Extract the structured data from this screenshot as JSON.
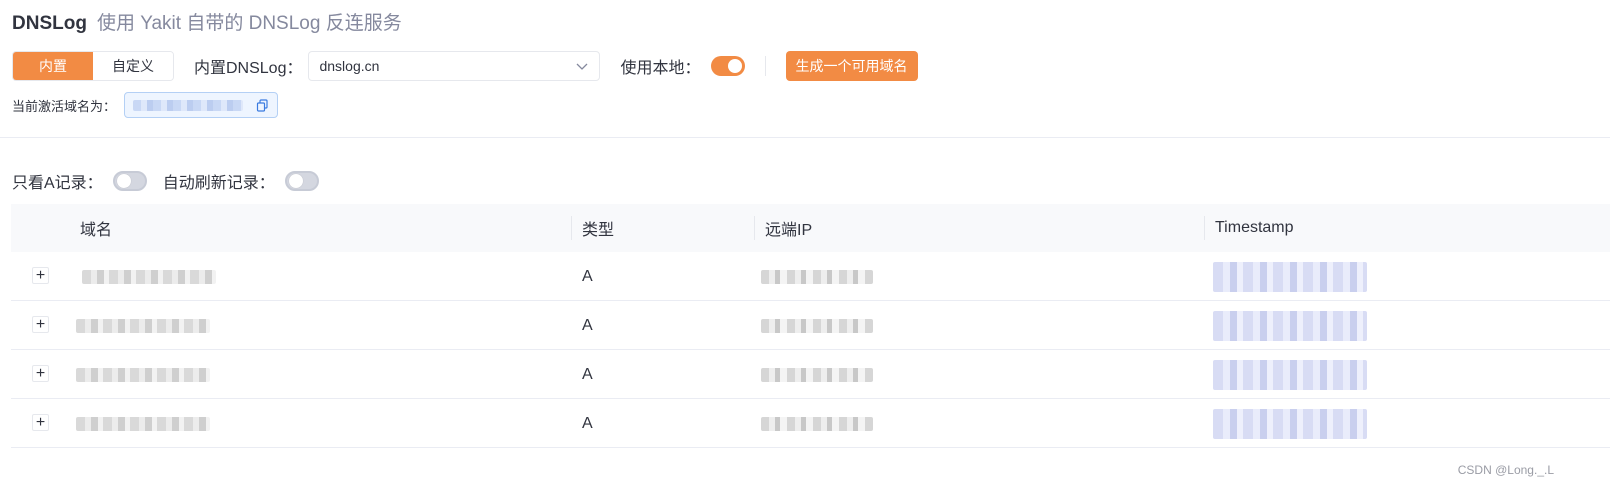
{
  "header": {
    "title": "DNSLog",
    "subtitle": "使用 Yakit 自带的 DNSLog 反连服务"
  },
  "toolbar": {
    "mode_options": [
      "内置",
      "自定义"
    ],
    "selected_mode": "内置",
    "builtin_label": "内置DNSLog：",
    "builtin_value": "dnslog.cn",
    "use_local_label": "使用本地：",
    "use_local_on": true,
    "generate_button": "生成一个可用域名"
  },
  "active_domain": {
    "label": "当前激活域名为："
  },
  "filters": {
    "only_a_label": "只看A记录：",
    "only_a_on": false,
    "auto_refresh_label": "自动刷新记录：",
    "auto_refresh_on": false
  },
  "table": {
    "columns": [
      "域名",
      "类型",
      "远端IP",
      "Timestamp"
    ],
    "rows": [
      {
        "type": "A"
      },
      {
        "type": "A"
      },
      {
        "type": "A"
      },
      {
        "type": "A"
      }
    ]
  },
  "colors": {
    "accent": "#f28b44",
    "text": "#31343f",
    "muted": "#85899e",
    "header_bg": "#f8f9fb"
  },
  "watermark": "CSDN @Long._.L"
}
